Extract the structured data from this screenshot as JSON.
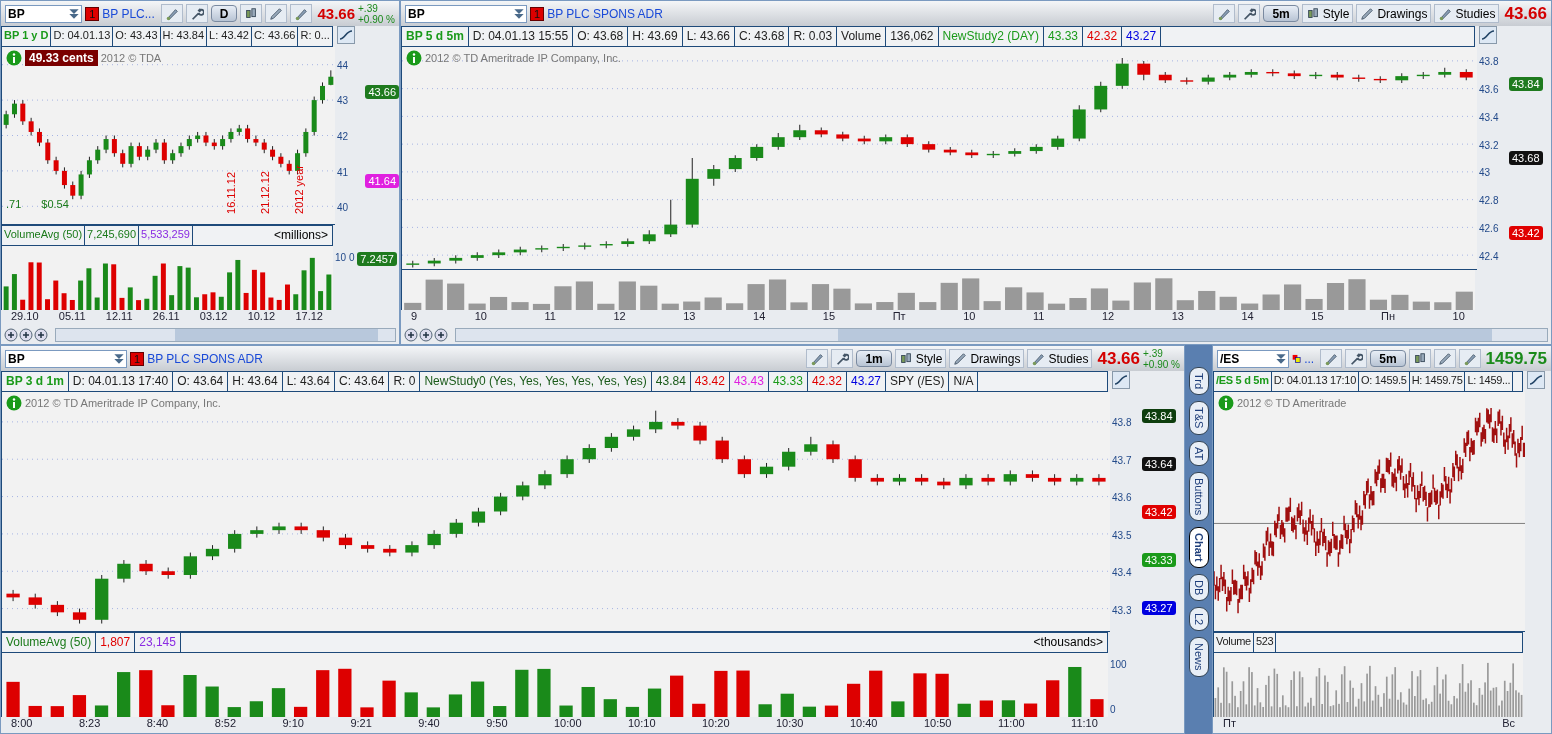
{
  "panels": [
    {
      "symbol": "BP",
      "flag": {
        "kind": "number",
        "text": "1"
      },
      "description": "BP PLC...",
      "toolbar": [
        {
          "kind": "pin"
        },
        {
          "kind": "wrench"
        },
        {
          "kind": "period",
          "text": "D"
        },
        {
          "kind": "style"
        },
        {
          "kind": "drawings"
        },
        {
          "kind": "studies"
        }
      ],
      "price": {
        "text": "43.66",
        "color": "#d40000"
      },
      "change": [
        "+.39",
        "+0.90 %"
      ],
      "info": [
        {
          "text": "BP 1 y D",
          "color": "#1a9a1a"
        },
        {
          "text": "D: 04.01.13",
          "color": "#222222"
        },
        {
          "text": "O: 43.43",
          "color": "#222222"
        },
        {
          "text": "H: 43.84",
          "color": "#222222"
        },
        {
          "text": "L: 43.42",
          "color": "#222222"
        },
        {
          "text": "C: 43.66",
          "color": "#222222"
        },
        {
          "text": "R: 0...",
          "color": "#222222"
        }
      ],
      "badge": "49.33 cents",
      "watermark": "2012 © TDA",
      "notes": [
        ".71",
        "$0.54"
      ],
      "vertical_labels": [
        "16.11.12",
        "21.12.12",
        "2012 year"
      ],
      "chart_data": {
        "type": "candlestick",
        "ylim": [
          39.5,
          44.5
        ],
        "yticks": [
          44,
          43,
          42,
          41,
          40
        ],
        "grid": true,
        "categories": [
          null,
          null,
          null,
          null,
          null,
          null,
          null,
          null,
          null,
          null,
          null,
          null,
          null,
          null,
          null,
          null,
          null,
          null,
          null,
          null,
          null,
          null,
          null,
          null,
          null,
          null,
          null,
          null,
          null,
          null,
          null,
          null,
          null,
          null,
          null,
          null,
          null,
          null,
          null,
          null
        ],
        "ohlc": [
          [
            42.3,
            42.7,
            42.2,
            42.6
          ],
          [
            42.6,
            43.0,
            42.5,
            42.9
          ],
          [
            42.9,
            43.0,
            42.3,
            42.4
          ],
          [
            42.4,
            42.5,
            42.0,
            42.1
          ],
          [
            42.1,
            42.2,
            41.7,
            41.8
          ],
          [
            41.8,
            41.9,
            41.2,
            41.3
          ],
          [
            41.3,
            41.4,
            40.9,
            41.0
          ],
          [
            41.0,
            41.1,
            40.5,
            40.6
          ],
          [
            40.6,
            40.7,
            40.2,
            40.3
          ],
          [
            40.3,
            41.0,
            40.2,
            40.9
          ],
          [
            40.9,
            41.4,
            40.8,
            41.3
          ],
          [
            41.3,
            41.7,
            41.2,
            41.6
          ],
          [
            41.6,
            42.0,
            41.5,
            41.9
          ],
          [
            41.9,
            42.0,
            41.4,
            41.5
          ],
          [
            41.5,
            41.6,
            41.1,
            41.2
          ],
          [
            41.2,
            41.8,
            41.1,
            41.7
          ],
          [
            41.7,
            41.8,
            41.3,
            41.4
          ],
          [
            41.4,
            41.7,
            41.3,
            41.6
          ],
          [
            41.6,
            41.9,
            41.5,
            41.8
          ],
          [
            41.8,
            41.9,
            41.2,
            41.3
          ],
          [
            41.3,
            41.6,
            41.2,
            41.5
          ],
          [
            41.5,
            41.8,
            41.4,
            41.7
          ],
          [
            41.7,
            42.0,
            41.6,
            41.9
          ],
          [
            41.9,
            42.1,
            41.8,
            42.0
          ],
          [
            42.0,
            42.1,
            41.7,
            41.8
          ],
          [
            41.8,
            41.9,
            41.6,
            41.7
          ],
          [
            41.7,
            42.0,
            41.6,
            41.9
          ],
          [
            41.9,
            42.2,
            41.8,
            42.1
          ],
          [
            42.1,
            42.3,
            42.0,
            42.2
          ],
          [
            42.2,
            42.3,
            41.8,
            41.9
          ],
          [
            41.9,
            42.0,
            41.7,
            41.8
          ],
          [
            41.8,
            41.9,
            41.5,
            41.6
          ],
          [
            41.6,
            41.7,
            41.3,
            41.4
          ],
          [
            41.4,
            41.5,
            41.1,
            41.2
          ],
          [
            41.2,
            41.3,
            40.9,
            41.0
          ],
          [
            41.0,
            41.6,
            40.9,
            41.5
          ],
          [
            41.5,
            42.2,
            41.4,
            42.1
          ],
          [
            42.1,
            43.1,
            42.0,
            43.0
          ],
          [
            43.0,
            43.5,
            42.9,
            43.4
          ],
          [
            43.43,
            43.84,
            43.42,
            43.66
          ]
        ]
      },
      "tags": [
        {
          "text": "43.66",
          "color": "#1e7a1e"
        },
        {
          "text": "41.64",
          "color": "#e020e0"
        }
      ],
      "volume": {
        "cells": [
          {
            "text": "VolumeAvg (50)",
            "color": "#1a7a1a"
          },
          {
            "text": "7,245,690",
            "color": "#1a7a1a"
          },
          {
            "text": "5,533,259",
            "color": "#8a2be2"
          }
        ],
        "unit": "<millions>",
        "y_ticks": [
          "10",
          "0"
        ],
        "tag": "7.2457"
      },
      "x_ticks": [
        "29.10",
        "05.11",
        "12.11",
        "26.11",
        "03.12",
        "10.12",
        "17.12"
      ],
      "scroll": true
    },
    {
      "symbol": "BP",
      "flag": {
        "kind": "number",
        "text": "1"
      },
      "description": "BP PLC SPONS ADR",
      "toolbar": [
        {
          "kind": "pin"
        },
        {
          "kind": "wrench"
        },
        {
          "kind": "period",
          "text": "5m"
        },
        {
          "kind": "style",
          "text": "Style"
        },
        {
          "kind": "drawings",
          "text": "Drawings"
        },
        {
          "kind": "studies",
          "text": "Studies"
        }
      ],
      "price": {
        "text": "43.66",
        "color": "#d40000"
      },
      "info": [
        {
          "text": "BP 5 d 5m",
          "color": "#1a9a1a"
        },
        {
          "text": "D: 04.01.13 15:55",
          "color": "#222222"
        },
        {
          "text": "O: 43.68",
          "color": "#222222"
        },
        {
          "text": "H: 43.69",
          "color": "#222222"
        },
        {
          "text": "L: 43.66",
          "color": "#222222"
        },
        {
          "text": "C: 43.68",
          "color": "#222222"
        },
        {
          "text": "R: 0.03",
          "color": "#222222"
        },
        {
          "text": "Volume",
          "color": "#222222"
        },
        {
          "text": "136,062",
          "color": "#222222"
        },
        {
          "text": "NewStudy2 (DAY)",
          "color": "#1a9a1a"
        },
        {
          "text": "43.33",
          "color": "#1a9a1a"
        },
        {
          "text": "42.32",
          "color": "#e00000"
        },
        {
          "text": "43.27",
          "color": "#0000e0"
        }
      ],
      "watermark": "2012 © TD Ameritrade IP Company, Inc.",
      "chart_data": {
        "type": "candlestick",
        "ylim": [
          42.3,
          43.9
        ],
        "yticks": [
          43.8,
          43.6,
          43.4,
          43.2,
          43,
          42.8,
          42.6,
          42.4
        ],
        "grid": true,
        "categories": [
          null,
          null,
          null,
          null,
          null,
          null,
          null,
          null,
          null,
          null,
          null,
          null,
          null,
          null,
          null,
          null,
          null,
          null,
          null,
          null,
          null,
          null,
          null,
          null,
          null,
          null,
          null,
          null,
          null,
          null,
          null,
          null,
          null,
          null,
          null,
          null,
          null,
          null,
          null,
          null,
          null,
          null,
          null,
          null,
          null,
          null,
          null,
          null,
          null,
          null
        ],
        "ohlc": [
          [
            42.33,
            42.36,
            42.31,
            42.34
          ],
          [
            42.34,
            42.38,
            42.32,
            42.36
          ],
          [
            42.36,
            42.4,
            42.34,
            42.38
          ],
          [
            42.38,
            42.42,
            42.36,
            42.4
          ],
          [
            42.4,
            42.44,
            42.38,
            42.42
          ],
          [
            42.42,
            42.46,
            42.4,
            42.44
          ],
          [
            42.44,
            42.47,
            42.42,
            42.45
          ],
          [
            42.45,
            42.48,
            42.43,
            42.46
          ],
          [
            42.46,
            42.49,
            42.44,
            42.47
          ],
          [
            42.47,
            42.5,
            42.45,
            42.48
          ],
          [
            42.48,
            42.52,
            42.46,
            42.5
          ],
          [
            42.5,
            42.58,
            42.48,
            42.55
          ],
          [
            42.55,
            42.8,
            42.53,
            42.62
          ],
          [
            42.62,
            43.1,
            42.6,
            42.95
          ],
          [
            42.95,
            43.05,
            42.9,
            43.02
          ],
          [
            43.02,
            43.12,
            43.0,
            43.1
          ],
          [
            43.1,
            43.2,
            43.08,
            43.18
          ],
          [
            43.18,
            43.28,
            43.16,
            43.25
          ],
          [
            43.25,
            43.34,
            43.23,
            43.3
          ],
          [
            43.3,
            43.32,
            43.25,
            43.27
          ],
          [
            43.27,
            43.29,
            43.22,
            43.24
          ],
          [
            43.24,
            43.26,
            43.2,
            43.22
          ],
          [
            43.22,
            43.27,
            43.2,
            43.25
          ],
          [
            43.25,
            43.27,
            43.18,
            43.2
          ],
          [
            43.2,
            43.22,
            43.14,
            43.16
          ],
          [
            43.16,
            43.18,
            43.12,
            43.14
          ],
          [
            43.14,
            43.16,
            43.1,
            43.12
          ],
          [
            43.12,
            43.15,
            43.1,
            43.13
          ],
          [
            43.13,
            43.17,
            43.11,
            43.15
          ],
          [
            43.15,
            43.2,
            43.13,
            43.18
          ],
          [
            43.18,
            43.26,
            43.16,
            43.24
          ],
          [
            43.24,
            43.48,
            43.22,
            43.45
          ],
          [
            43.45,
            43.65,
            43.43,
            43.62
          ],
          [
            43.62,
            43.82,
            43.6,
            43.78
          ],
          [
            43.78,
            43.8,
            43.66,
            43.7
          ],
          [
            43.7,
            43.72,
            43.64,
            43.66
          ],
          [
            43.66,
            43.68,
            43.63,
            43.65
          ],
          [
            43.65,
            43.7,
            43.63,
            43.68
          ],
          [
            43.68,
            43.72,
            43.66,
            43.7
          ],
          [
            43.7,
            43.74,
            43.68,
            43.72
          ],
          [
            43.72,
            43.74,
            43.69,
            43.71
          ],
          [
            43.71,
            43.73,
            43.67,
            43.69
          ],
          [
            43.69,
            43.72,
            43.67,
            43.7
          ],
          [
            43.7,
            43.72,
            43.66,
            43.68
          ],
          [
            43.68,
            43.7,
            43.65,
            43.67
          ],
          [
            43.67,
            43.69,
            43.64,
            43.66
          ],
          [
            43.66,
            43.71,
            43.64,
            43.69
          ],
          [
            43.69,
            43.72,
            43.67,
            43.7
          ],
          [
            43.7,
            43.75,
            43.68,
            43.72
          ],
          [
            43.72,
            43.74,
            43.66,
            43.68
          ]
        ]
      },
      "tags": [
        {
          "text": "43.84",
          "color": "#1e7a1e"
        },
        {
          "text": "43.68",
          "color": "#111111"
        },
        {
          "text": "43.42",
          "color": "#e00000"
        }
      ],
      "x_ticks": [
        "9",
        "10",
        "11",
        "12",
        "13",
        "14",
        "15",
        "Пт",
        "10",
        "11",
        "12",
        "13",
        "14",
        "15",
        "Пн",
        "10"
      ],
      "scroll": true
    },
    {
      "symbol": "BP",
      "flag": {
        "kind": "number",
        "text": "1"
      },
      "description": "BP PLC SPONS ADR",
      "toolbar": [
        {
          "kind": "pin"
        },
        {
          "kind": "wrench"
        },
        {
          "kind": "period",
          "text": "1m"
        },
        {
          "kind": "style",
          "text": "Style"
        },
        {
          "kind": "drawings",
          "text": "Drawings"
        },
        {
          "kind": "studies",
          "text": "Studies"
        }
      ],
      "price": {
        "text": "43.66",
        "color": "#d40000"
      },
      "change": [
        "+.39",
        "+0.90 %"
      ],
      "info": [
        {
          "text": "BP 3 d 1m",
          "color": "#1a9a1a"
        },
        {
          "text": "D: 04.01.13 17:40",
          "color": "#222222"
        },
        {
          "text": "O: 43.64",
          "color": "#222222"
        },
        {
          "text": "H: 43.64",
          "color": "#222222"
        },
        {
          "text": "L: 43.64",
          "color": "#222222"
        },
        {
          "text": "C: 43.64",
          "color": "#222222"
        },
        {
          "text": "R: 0",
          "color": "#222222"
        },
        {
          "text": "NewStudy0 (Yes, Yes, Yes, Yes, Yes, Yes)",
          "color": "#1a5a1a"
        },
        {
          "text": "43.84",
          "color": "#1a5a1a"
        },
        {
          "text": "43.42",
          "color": "#e00000"
        },
        {
          "text": "43.43",
          "color": "#e020e0"
        },
        {
          "text": "43.33",
          "color": "#1a9a1a"
        },
        {
          "text": "42.32",
          "color": "#e00000"
        },
        {
          "text": "43.27",
          "color": "#0000e0"
        },
        {
          "text": "SPY (/ES)",
          "color": "#222222"
        },
        {
          "text": "N/A",
          "color": "#222222"
        }
      ],
      "watermark": "2012 © TD Ameritrade IP Company, Inc.",
      "chart_data": {
        "type": "candlestick",
        "ylim": [
          43.24,
          43.88
        ],
        "yticks": [
          43.8,
          43.7,
          43.6,
          43.5,
          43.4,
          43.3
        ],
        "grid": true,
        "categories": [
          null,
          null,
          null,
          null,
          null,
          null,
          null,
          null,
          null,
          null,
          null,
          null,
          null,
          null,
          null,
          null,
          null,
          null,
          null,
          null,
          null,
          null,
          null,
          null,
          null,
          null,
          null,
          null,
          null,
          null,
          null,
          null,
          null,
          null,
          null,
          null,
          null,
          null,
          null,
          null,
          null,
          null,
          null,
          null,
          null,
          null,
          null,
          null,
          null,
          null
        ],
        "ohlc": [
          [
            43.34,
            43.35,
            43.32,
            43.33
          ],
          [
            43.33,
            43.34,
            43.3,
            43.31
          ],
          [
            43.31,
            43.32,
            43.28,
            43.29
          ],
          [
            43.29,
            43.3,
            43.26,
            43.27
          ],
          [
            43.27,
            43.39,
            43.26,
            43.38
          ],
          [
            43.38,
            43.43,
            43.37,
            43.42
          ],
          [
            43.42,
            43.43,
            43.39,
            43.4
          ],
          [
            43.4,
            43.41,
            43.38,
            43.39
          ],
          [
            43.39,
            43.45,
            43.38,
            43.44
          ],
          [
            43.44,
            43.47,
            43.43,
            43.46
          ],
          [
            43.46,
            43.51,
            43.45,
            43.5
          ],
          [
            43.5,
            43.52,
            43.49,
            43.51
          ],
          [
            43.51,
            43.53,
            43.5,
            43.52
          ],
          [
            43.52,
            43.53,
            43.5,
            43.51
          ],
          [
            43.51,
            43.52,
            43.48,
            43.49
          ],
          [
            43.49,
            43.5,
            43.46,
            43.47
          ],
          [
            43.47,
            43.48,
            43.45,
            43.46
          ],
          [
            43.46,
            43.47,
            43.44,
            43.45
          ],
          [
            43.45,
            43.48,
            43.44,
            43.47
          ],
          [
            43.47,
            43.51,
            43.46,
            43.5
          ],
          [
            43.5,
            43.54,
            43.49,
            43.53
          ],
          [
            43.53,
            43.57,
            43.52,
            43.56
          ],
          [
            43.56,
            43.61,
            43.55,
            43.6
          ],
          [
            43.6,
            43.64,
            43.59,
            43.63
          ],
          [
            43.63,
            43.67,
            43.62,
            43.66
          ],
          [
            43.66,
            43.71,
            43.65,
            43.7
          ],
          [
            43.7,
            43.74,
            43.69,
            43.73
          ],
          [
            43.73,
            43.77,
            43.72,
            43.76
          ],
          [
            43.76,
            43.79,
            43.75,
            43.78
          ],
          [
            43.78,
            43.83,
            43.77,
            43.8
          ],
          [
            43.8,
            43.81,
            43.78,
            43.79
          ],
          [
            43.79,
            43.8,
            43.74,
            43.75
          ],
          [
            43.75,
            43.76,
            43.69,
            43.7
          ],
          [
            43.7,
            43.71,
            43.65,
            43.66
          ],
          [
            43.66,
            43.69,
            43.65,
            43.68
          ],
          [
            43.68,
            43.73,
            43.67,
            43.72
          ],
          [
            43.72,
            43.76,
            43.71,
            43.74
          ],
          [
            43.74,
            43.75,
            43.69,
            43.7
          ],
          [
            43.7,
            43.71,
            43.64,
            43.65
          ],
          [
            43.65,
            43.66,
            43.63,
            43.64
          ],
          [
            43.64,
            43.66,
            43.63,
            43.65
          ],
          [
            43.65,
            43.66,
            43.63,
            43.64
          ],
          [
            43.64,
            43.65,
            43.62,
            43.63
          ],
          [
            43.63,
            43.66,
            43.62,
            43.65
          ],
          [
            43.65,
            43.66,
            43.63,
            43.64
          ],
          [
            43.64,
            43.67,
            43.63,
            43.66
          ],
          [
            43.66,
            43.67,
            43.64,
            43.65
          ],
          [
            43.65,
            43.66,
            43.63,
            43.64
          ],
          [
            43.64,
            43.66,
            43.63,
            43.65
          ],
          [
            43.65,
            43.66,
            43.63,
            43.64
          ]
        ]
      },
      "tags": [
        {
          "text": "43.84",
          "color": "#0e3e0e"
        },
        {
          "text": "43.64",
          "color": "#111111"
        },
        {
          "text": "43.42",
          "color": "#e00000"
        },
        {
          "text": "43.33",
          "color": "#1a9a1a"
        },
        {
          "text": "43.27",
          "color": "#0000e0"
        }
      ],
      "volume": {
        "cells": [
          {
            "text": "VolumeAvg (50)",
            "color": "#1a7a1a"
          },
          {
            "text": "1,807",
            "color": "#e00000"
          },
          {
            "text": "23,145",
            "color": "#8a2be2"
          }
        ],
        "unit": "<thousands>",
        "y_ticks": [
          "100",
          "0"
        ]
      },
      "x_ticks": [
        "8:00",
        "8:23",
        "8:40",
        "8:52",
        "9:10",
        "9:21",
        "9:40",
        "9:50",
        "10:00",
        "10:10",
        "10:20",
        "10:30",
        "10:40",
        "10:50",
        "11:00",
        "11:10"
      ]
    },
    {
      "symbol": "/ES",
      "flag": {
        "kind": "linked",
        "text": "..."
      },
      "toolbar": [
        {
          "kind": "pin"
        },
        {
          "kind": "wrench"
        },
        {
          "kind": "period",
          "text": "5m"
        },
        {
          "kind": "style"
        },
        {
          "kind": "drawings"
        },
        {
          "kind": "studies"
        }
      ],
      "price": {
        "text": "1459.75",
        "color": "#1a8a1a"
      },
      "info": [
        {
          "text": "/ES 5 d 5m",
          "color": "#1a9a1a"
        },
        {
          "text": "D: 04.01.13 17:10",
          "color": "#222222"
        },
        {
          "text": "O: 1459.5",
          "color": "#222222"
        },
        {
          "text": "H: 1459.75",
          "color": "#222222"
        },
        {
          "text": "L: 1459...",
          "color": "#222222"
        }
      ],
      "watermark": "2012 © TD Ameritrade",
      "volume": {
        "cells": [
          {
            "text": "Volume",
            "color": "#222222"
          },
          {
            "text": "523",
            "color": "#222222"
          }
        ]
      },
      "x_ticks": [
        "Пт",
        "Вс"
      ]
    }
  ],
  "side_tabs": [
    {
      "label": "Trd",
      "selected": false
    },
    {
      "label": "T&S",
      "selected": false
    },
    {
      "label": "AT",
      "selected": false
    },
    {
      "label": "Buttons",
      "selected": false
    },
    {
      "label": "Chart",
      "selected": true
    },
    {
      "label": "DB",
      "selected": false
    },
    {
      "label": "L2",
      "selected": false
    },
    {
      "label": "News",
      "selected": false
    }
  ]
}
